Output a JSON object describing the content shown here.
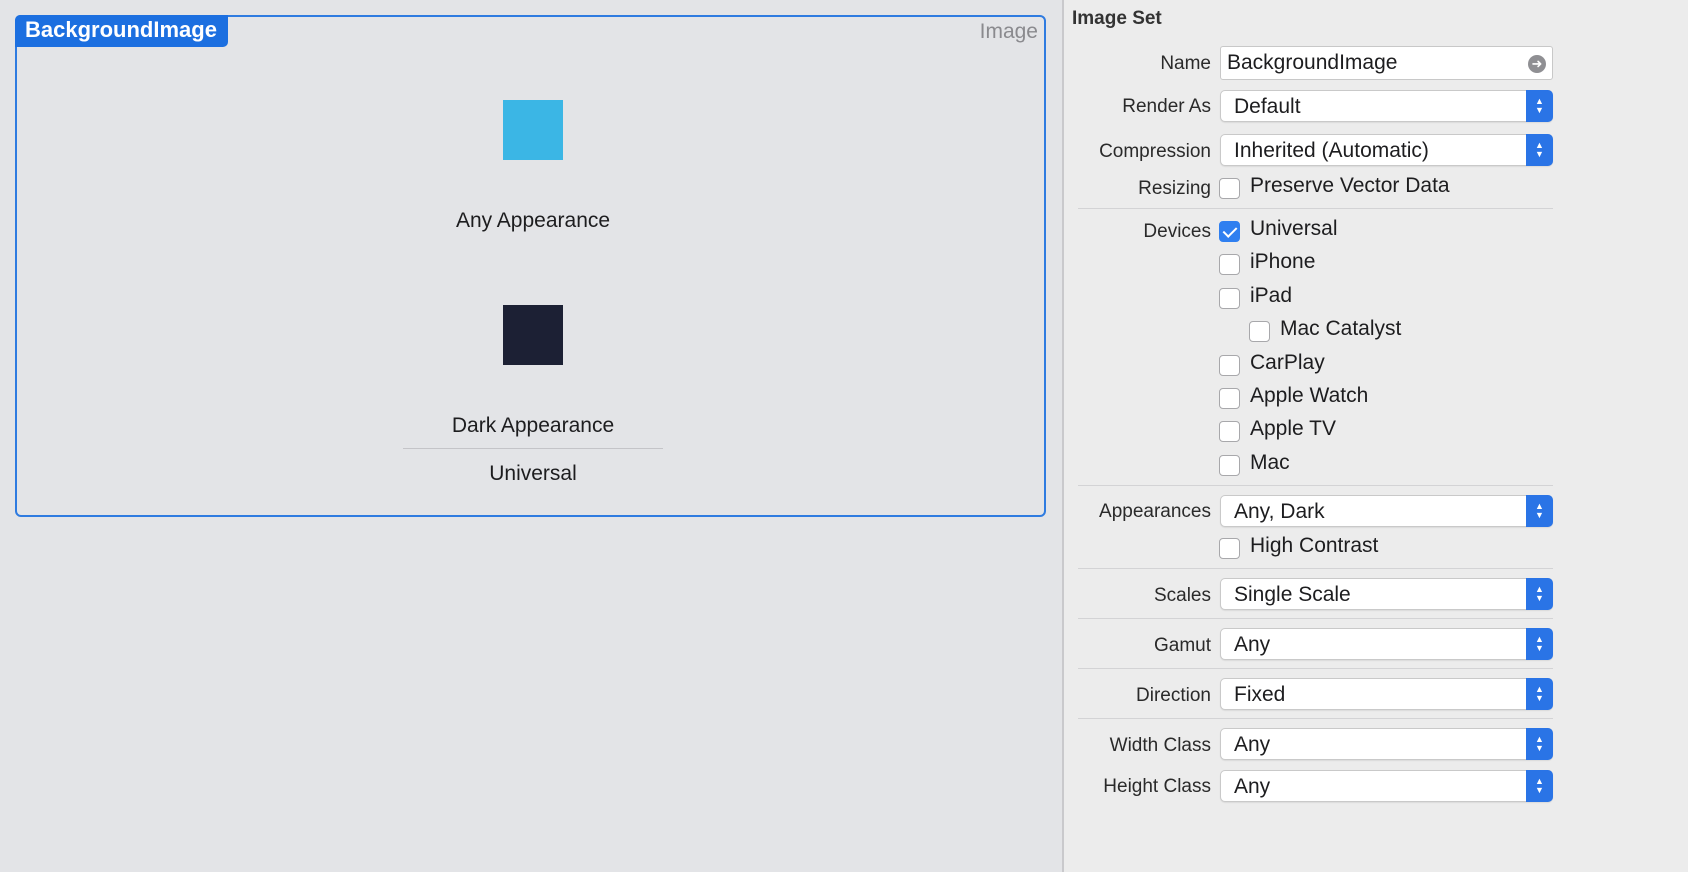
{
  "asset": {
    "name_tag": "BackgroundImage",
    "kind": "Image",
    "slots": [
      {
        "caption": "Any Appearance",
        "color": "#3bb6e5"
      },
      {
        "caption": "Dark Appearance",
        "color": "#1c2034"
      }
    ],
    "group_label": "Universal"
  },
  "inspector": {
    "title": "Image Set",
    "name": {
      "label": "Name",
      "value": "BackgroundImage",
      "icon": "go-arrow-icon"
    },
    "render_as": {
      "label": "Render As",
      "value": "Default"
    },
    "compression": {
      "label": "Compression",
      "value": "Inherited (Automatic)"
    },
    "resizing": {
      "label": "Resizing",
      "option": "Preserve Vector Data",
      "checked": false
    },
    "devices": {
      "label": "Devices",
      "items": [
        {
          "label": "Universal",
          "checked": true
        },
        {
          "label": "iPhone",
          "checked": false
        },
        {
          "label": "iPad",
          "checked": false
        },
        {
          "label": "Mac Catalyst",
          "checked": false
        },
        {
          "label": "CarPlay",
          "checked": false
        },
        {
          "label": "Apple Watch",
          "checked": false
        },
        {
          "label": "Apple TV",
          "checked": false
        },
        {
          "label": "Mac",
          "checked": false
        }
      ]
    },
    "appearances": {
      "label": "Appearances",
      "value": "Any, Dark",
      "high_contrast": "High Contrast",
      "high_contrast_checked": false
    },
    "scales": {
      "label": "Scales",
      "value": "Single Scale"
    },
    "gamut": {
      "label": "Gamut",
      "value": "Any"
    },
    "direction": {
      "label": "Direction",
      "value": "Fixed"
    },
    "width_class": {
      "label": "Width Class",
      "value": "Any"
    },
    "height_class": {
      "label": "Height Class",
      "value": "Any"
    }
  },
  "colors": {
    "accent": "#2a74e6",
    "selection_border": "#2f7be0",
    "editor_bg": "#e3e4e7",
    "inspector_bg": "#ececec"
  }
}
